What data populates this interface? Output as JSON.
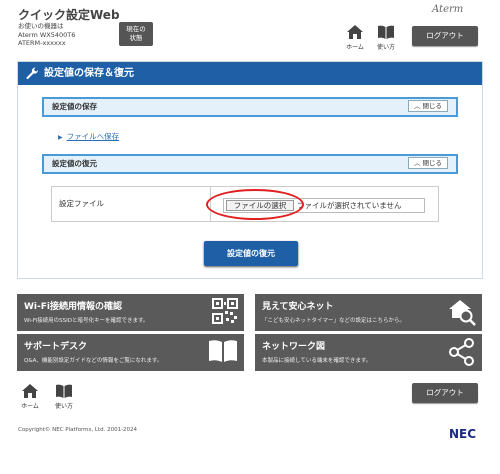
{
  "header": {
    "app_title": "クイック設定Web",
    "device_line1": "お使いの機器は",
    "device_line2": "Aterm WX5400T6",
    "device_line3": "ATERM-xxxxxx",
    "status_btn_line1": "現在の",
    "status_btn_line2": "状態",
    "brand": "Aterm",
    "home_label": "ホーム",
    "howto_label": "使い方",
    "logout_label": "ログアウト"
  },
  "main": {
    "title": "設定値の保存＆復元",
    "save_section": {
      "title": "設定値の保存",
      "close_label": "閉じる",
      "link_label": "ファイルへ保存"
    },
    "restore_section": {
      "title": "設定値の復元",
      "close_label": "閉じる",
      "file_label": "設定ファイル",
      "choose_button": "ファイルの選択",
      "no_file_text": "ファイルが選択されていません",
      "restore_button": "設定値の復元"
    }
  },
  "tiles": [
    {
      "title": "Wi-Fi接続用情報の確認",
      "desc": "Wi-Fi接続用のSSIDと暗号化キーを確認できます。",
      "icon": "qr-code-icon"
    },
    {
      "title": "見えて安心ネット",
      "desc": "「こども安心ネットタイマー」などの設定はこちらから。",
      "icon": "house-search-icon"
    },
    {
      "title": "サポートデスク",
      "desc": "Q&A、機能別設定ガイドなどの情報をご覧になれます。",
      "icon": "book-icon"
    },
    {
      "title": "ネットワーク図",
      "desc": "本製品に接続している端末を確認できます。",
      "icon": "network-icon"
    }
  ],
  "footer": {
    "home_label": "ホーム",
    "howto_label": "使い方",
    "logout_label": "ログアウト",
    "copyright": "Copyright© NEC Platforms, Ltd. 2001-2024",
    "brand": "NEC"
  },
  "colors": {
    "accent": "#1e5fa6",
    "section_border": "#4a9ad8",
    "tile_bg": "#5a5a5a",
    "highlight": "#e02020"
  }
}
